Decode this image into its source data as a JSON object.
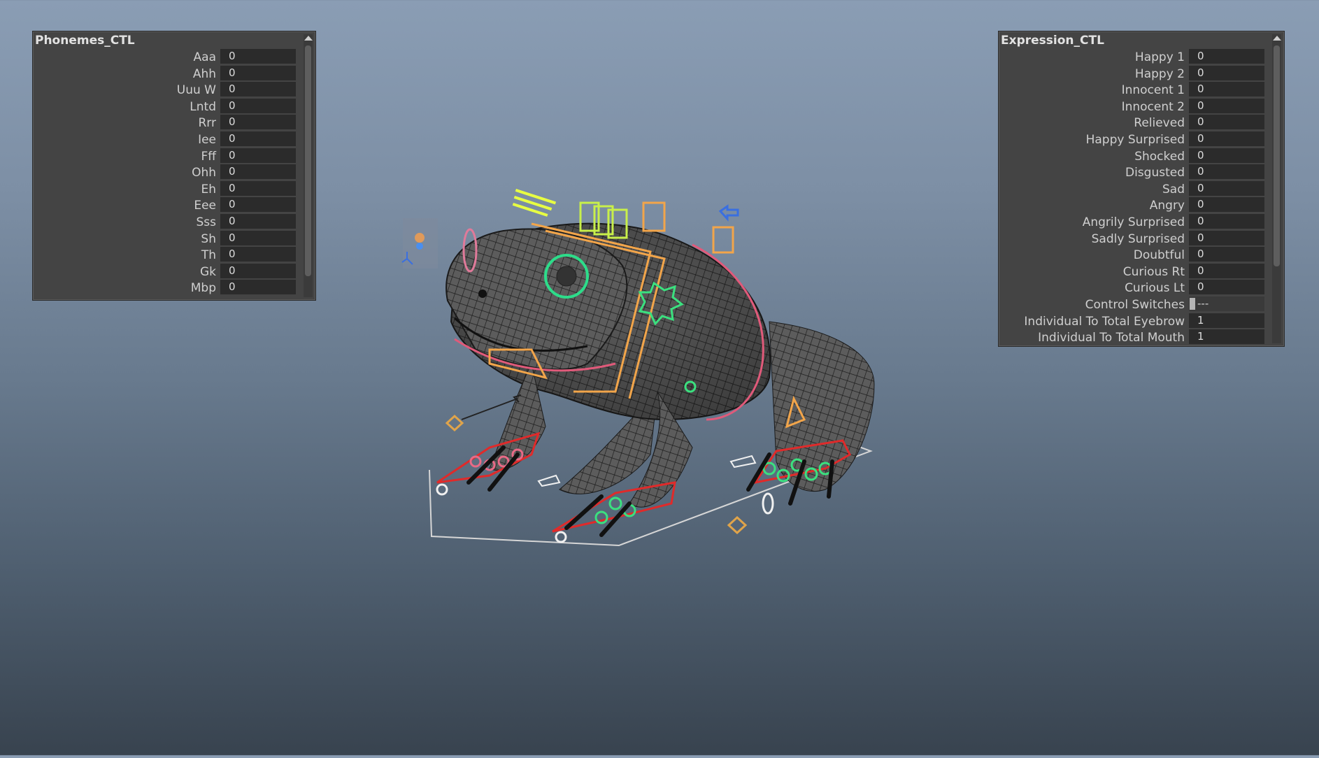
{
  "viewport": {
    "model": "frog-rig",
    "background_top": "#8a9db4",
    "background_bottom": "#38434f"
  },
  "phonemes_panel": {
    "title": "Phonemes_CTL",
    "channels": [
      {
        "label": "Aaa",
        "value": "0"
      },
      {
        "label": "Ahh",
        "value": "0"
      },
      {
        "label": "Uuu W",
        "value": "0"
      },
      {
        "label": "Lntd",
        "value": "0"
      },
      {
        "label": "Rrr",
        "value": "0"
      },
      {
        "label": "Iee",
        "value": "0"
      },
      {
        "label": "Fff",
        "value": "0"
      },
      {
        "label": "Ohh",
        "value": "0"
      },
      {
        "label": "Eh",
        "value": "0"
      },
      {
        "label": "Eee",
        "value": "0"
      },
      {
        "label": "Sss",
        "value": "0"
      },
      {
        "label": "Sh",
        "value": "0"
      },
      {
        "label": "Th",
        "value": "0"
      },
      {
        "label": "Gk",
        "value": "0"
      },
      {
        "label": "Mbp",
        "value": "0"
      }
    ]
  },
  "expression_panel": {
    "title": "Expression_CTL",
    "channels": [
      {
        "label": "Happy 1",
        "value": "0"
      },
      {
        "label": "Happy 2",
        "value": "0"
      },
      {
        "label": "Innocent 1",
        "value": "0"
      },
      {
        "label": "Innocent 2",
        "value": "0"
      },
      {
        "label": "Relieved",
        "value": "0"
      },
      {
        "label": "Happy Surprised",
        "value": "0"
      },
      {
        "label": "Shocked",
        "value": "0"
      },
      {
        "label": "Disgusted",
        "value": "0"
      },
      {
        "label": "Sad",
        "value": "0"
      },
      {
        "label": "Angry",
        "value": "0"
      },
      {
        "label": "Angrily Surprised",
        "value": "0"
      },
      {
        "label": "Sadly Surprised",
        "value": "0"
      },
      {
        "label": "Doubtful",
        "value": "0"
      },
      {
        "label": "Curious Rt",
        "value": "0"
      },
      {
        "label": "Curious Lt",
        "value": "0"
      },
      {
        "label": "Control Switches",
        "value": "---"
      },
      {
        "label": "Individual To Total Eyebrow",
        "value": "1"
      },
      {
        "label": "Individual To Total Mouth",
        "value": "1"
      }
    ]
  }
}
